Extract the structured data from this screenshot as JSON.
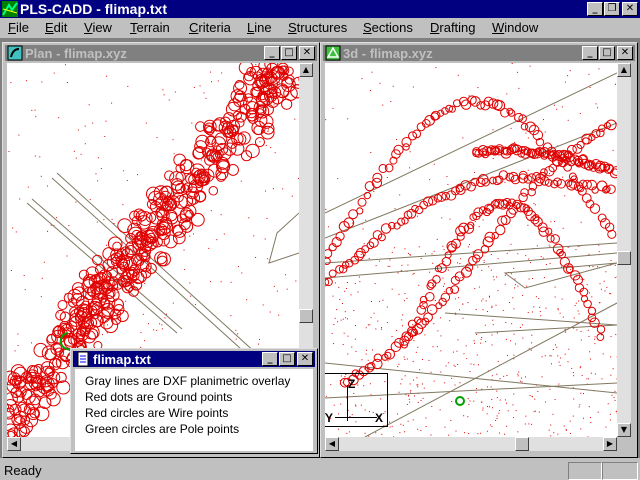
{
  "app": {
    "title": "PLS-CADD - flimap.txt",
    "buttons": [
      "_",
      "❐",
      "✕"
    ]
  },
  "menu": [
    {
      "label": "File",
      "key": "F",
      "rest": "ile"
    },
    {
      "label": "Edit",
      "key": "E",
      "rest": "dit"
    },
    {
      "label": "View",
      "key": "V",
      "rest": "iew"
    },
    {
      "label": "Terrain",
      "key": "T",
      "rest": "errain"
    },
    {
      "label": "Criteria",
      "key": "C",
      "rest": "riteria"
    },
    {
      "label": "Line",
      "key": "L",
      "rest": "ine"
    },
    {
      "label": "Structures",
      "key": "S",
      "rest": "tructures"
    },
    {
      "label": "Sections",
      "key": "S",
      "rest": "ections"
    },
    {
      "label": "Drafting",
      "key": "D",
      "rest": "rafting"
    },
    {
      "label": "Window",
      "key": "W",
      "rest": "indow"
    }
  ],
  "windows": {
    "plan": {
      "title": "Plan - flimap.xyz"
    },
    "view3d": {
      "title": "3d - flimap.xyz"
    },
    "legend": {
      "title": "flimap.txt",
      "lines": [
        "Gray lines are DXF planimetric overlay",
        "Red dots are Ground points",
        "Red circles are Wire points",
        "Green circles are Pole points"
      ]
    }
  },
  "axes": {
    "z": "Z",
    "y": "Y",
    "x": "X"
  },
  "status": {
    "text": "Ready"
  },
  "colors": {
    "active_title": "#000080",
    "inactive_title": "#808080",
    "wire_points": "#e00000",
    "ground_points": "#e00000",
    "pole_points": "#00a000",
    "dxf_overlay": "#807860"
  },
  "icons": {
    "app": "pls-cadd-icon",
    "plan": "plan-icon",
    "view3d": "3d-icon",
    "legend": "text-file-icon"
  }
}
